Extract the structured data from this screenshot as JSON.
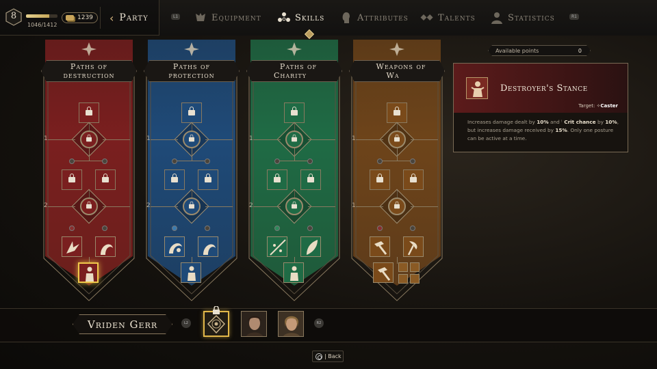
{
  "header": {
    "level": "8",
    "xp_text": "1046/1412",
    "xp_progress": 0.74,
    "gold": "1239",
    "party_label": "Party",
    "hint_left": "L1",
    "hint_right": "R1",
    "tabs": [
      {
        "label": "Equipment",
        "icon": "equipment-icon",
        "active": false
      },
      {
        "label": "Skills",
        "icon": "skills-icon",
        "active": true
      },
      {
        "label": "Attributes",
        "icon": "attributes-icon",
        "active": false
      },
      {
        "label": "Talents",
        "icon": "talents-icon",
        "active": false
      },
      {
        "label": "Statistics",
        "icon": "statistics-icon",
        "active": false
      }
    ]
  },
  "trees": [
    {
      "title_1": "Paths of",
      "title_2": "destruction",
      "color": "#7a1f1f",
      "tier_1": "1",
      "tier_2": "2"
    },
    {
      "title_1": "Paths of",
      "title_2": "protection",
      "color": "#1f4a78",
      "tier_1": "1",
      "tier_2": "2"
    },
    {
      "title_1": "Paths of Charity",
      "title_2": "",
      "color": "#1f6b45",
      "tier_1": "1",
      "tier_2": "2"
    },
    {
      "title_1": "Weapons of Wa",
      "title_2": "",
      "color": "#7a4a1a",
      "tier_1": "1",
      "tier_2": "1"
    }
  ],
  "available_points": {
    "label": "Available points",
    "value": "0"
  },
  "skill_info": {
    "name": "Destroyer's Stance",
    "target_label": "Target:",
    "target_value": "Caster",
    "desc_1": "Increases damage dealt by ",
    "v1": "10%",
    "desc_2": " and ",
    "desc_3": "Crit chance",
    "desc_4": " by ",
    "v2": "10%",
    "desc_5": ", but increases damage received by ",
    "v3": "15%",
    "desc_6": ". Only one posture can be active at a time."
  },
  "party_bar": {
    "character_name": "Vriden Gerr",
    "hint_left": "L2",
    "hint_right": "R2"
  },
  "footer": {
    "back_label": "| Back"
  },
  "colors": {
    "accent": "#f0c94a",
    "destruction": "#7a1f1f",
    "protection": "#1f4a78",
    "charity": "#1f6b45",
    "weapons": "#7a4a1a"
  }
}
